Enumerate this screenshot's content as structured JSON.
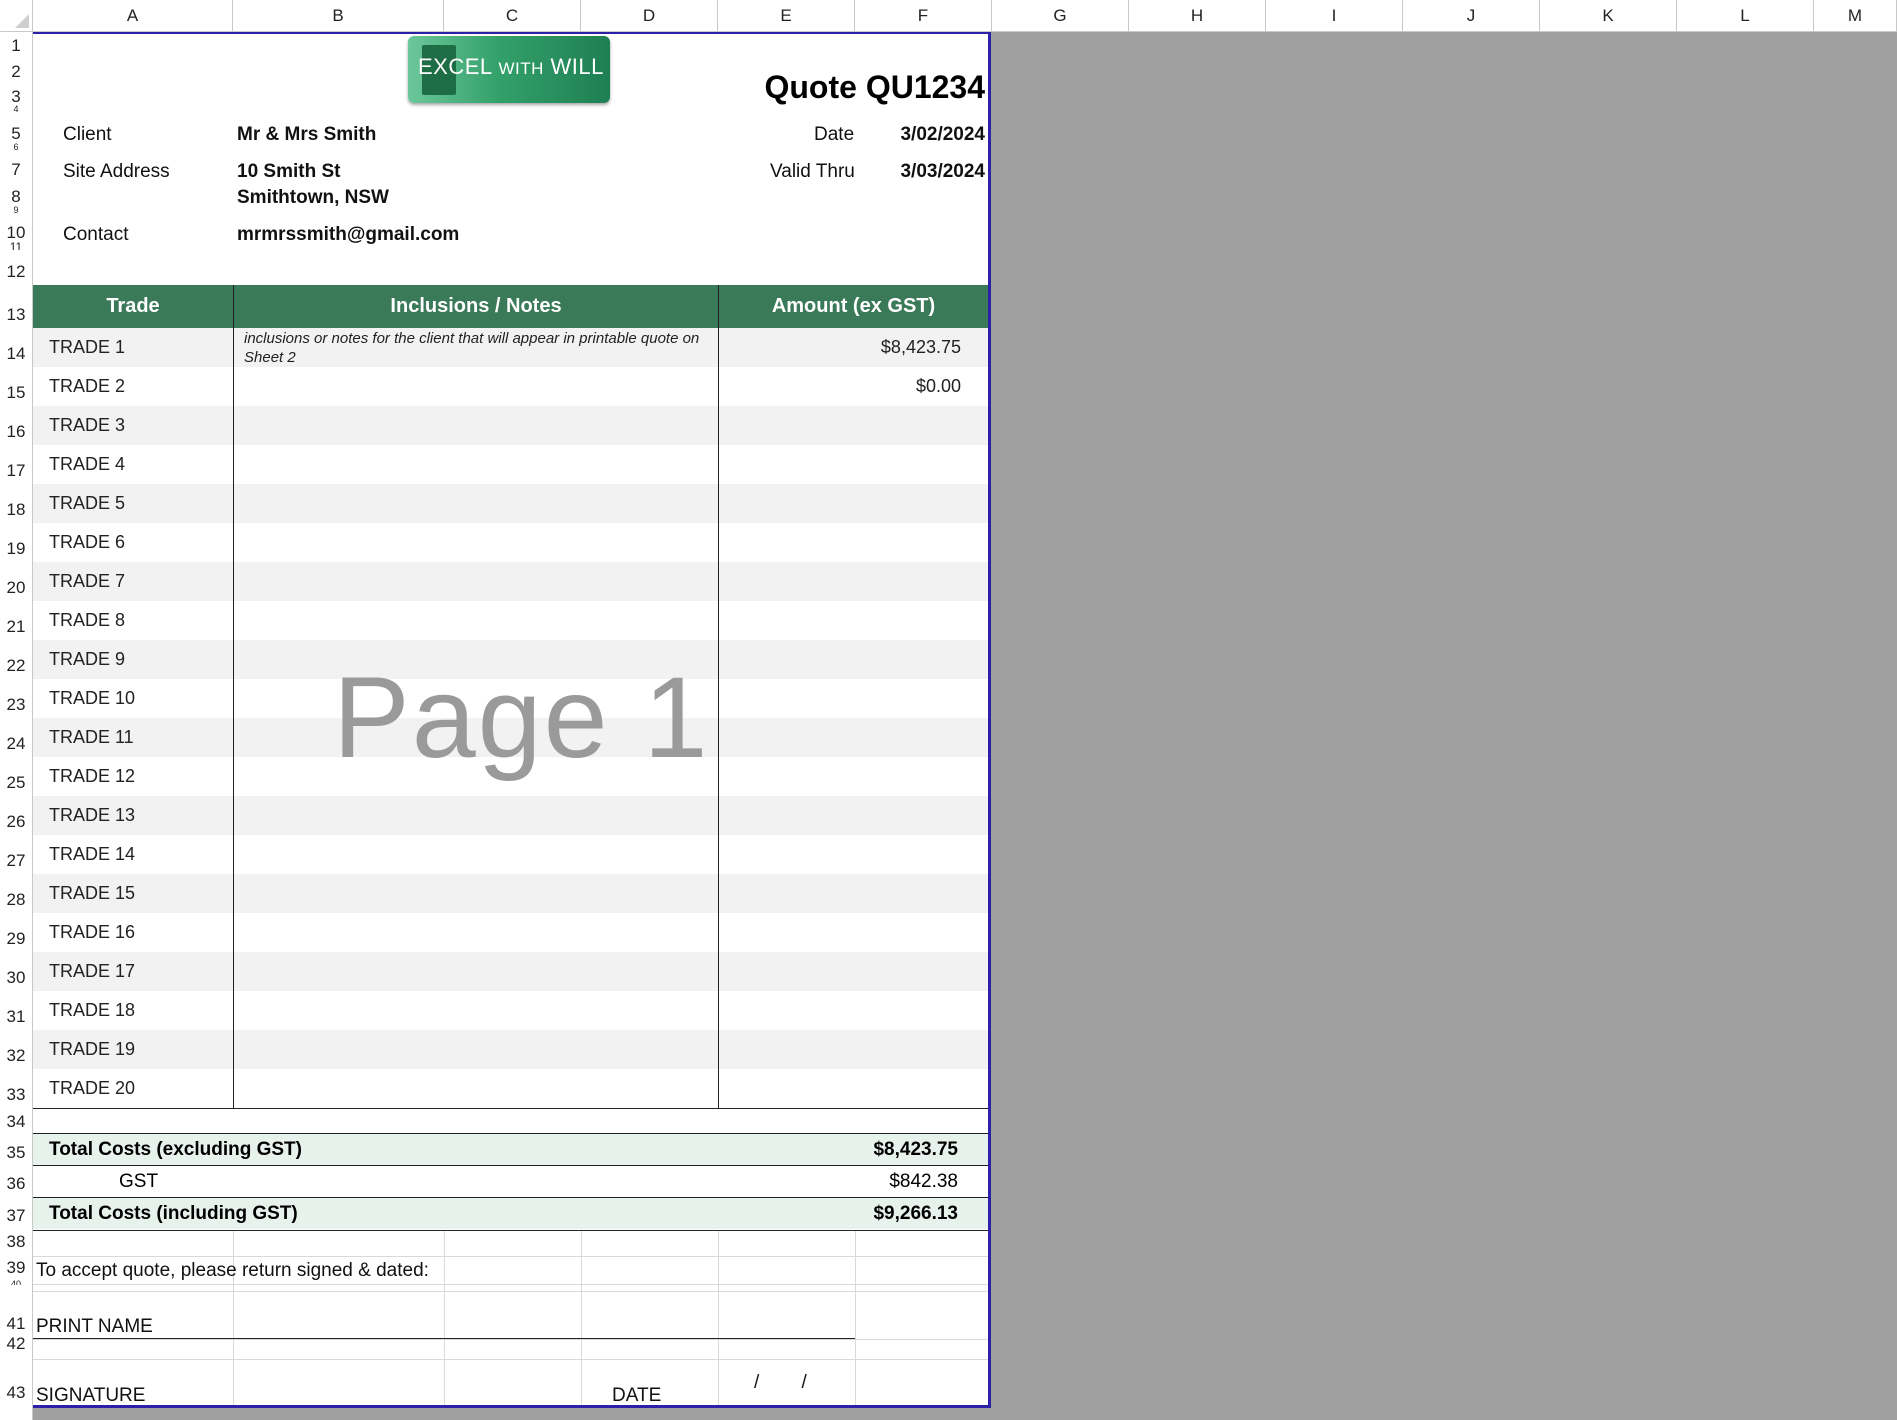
{
  "columns": [
    "A",
    "B",
    "C",
    "D",
    "E",
    "F",
    "G",
    "H",
    "I",
    "J",
    "K",
    "L",
    "M"
  ],
  "rows": [
    "1",
    "2",
    "3",
    "4",
    "5",
    "6",
    "7",
    "8",
    "9",
    "10",
    "11",
    "12",
    "13",
    "14",
    "15",
    "16",
    "17",
    "18",
    "19",
    "20",
    "21",
    "22",
    "23",
    "24",
    "25",
    "26",
    "27",
    "28",
    "29",
    "30",
    "31",
    "32",
    "33",
    "34",
    "35",
    "36",
    "37",
    "38",
    "39",
    "40",
    "41",
    "42",
    "43"
  ],
  "logo": {
    "text_main": "EXCEL",
    "text_with": "WITH",
    "text_name": "WILL"
  },
  "quote": {
    "title": "Quote QU1234",
    "client_label": "Client",
    "client_value": "Mr & Mrs Smith",
    "site_label": "Site Address",
    "site_line1": "10 Smith St",
    "site_line2": "Smithtown, NSW",
    "contact_label": "Contact",
    "contact_value": "mrmrssmith@gmail.com",
    "date_label": "Date",
    "date_value": "3/02/2024",
    "valid_label": "Valid Thru",
    "valid_value": "3/03/2024"
  },
  "table": {
    "headers": {
      "trade": "Trade",
      "notes": "Inclusions / Notes",
      "amount": "Amount (ex GST)"
    },
    "rows": [
      {
        "trade": "TRADE 1",
        "notes": "inclusions or notes for the client that will appear in printable quote on Sheet 2",
        "amount": "$8,423.75"
      },
      {
        "trade": "TRADE 2",
        "notes": "",
        "amount": "$0.00"
      },
      {
        "trade": "TRADE 3",
        "notes": "",
        "amount": ""
      },
      {
        "trade": "TRADE 4",
        "notes": "",
        "amount": ""
      },
      {
        "trade": "TRADE 5",
        "notes": "",
        "amount": ""
      },
      {
        "trade": "TRADE 6",
        "notes": "",
        "amount": ""
      },
      {
        "trade": "TRADE 7",
        "notes": "",
        "amount": ""
      },
      {
        "trade": "TRADE 8",
        "notes": "",
        "amount": ""
      },
      {
        "trade": "TRADE 9",
        "notes": "",
        "amount": ""
      },
      {
        "trade": "TRADE 10",
        "notes": "",
        "amount": ""
      },
      {
        "trade": "TRADE 11",
        "notes": "",
        "amount": ""
      },
      {
        "trade": "TRADE 12",
        "notes": "",
        "amount": ""
      },
      {
        "trade": "TRADE 13",
        "notes": "",
        "amount": ""
      },
      {
        "trade": "TRADE 14",
        "notes": "",
        "amount": ""
      },
      {
        "trade": "TRADE 15",
        "notes": "",
        "amount": ""
      },
      {
        "trade": "TRADE 16",
        "notes": "",
        "amount": ""
      },
      {
        "trade": "TRADE 17",
        "notes": "",
        "amount": ""
      },
      {
        "trade": "TRADE 18",
        "notes": "",
        "amount": ""
      },
      {
        "trade": "TRADE 19",
        "notes": "",
        "amount": ""
      },
      {
        "trade": "TRADE 20",
        "notes": "",
        "amount": ""
      }
    ]
  },
  "watermark": "Page 1",
  "totals": {
    "excl_label": "Total Costs (excluding GST)",
    "excl_value": "$8,423.75",
    "gst_label": "GST",
    "gst_value": "$842.38",
    "incl_label": "Total Costs (including GST)",
    "incl_value": "$9,266.13"
  },
  "accept": {
    "instruction": "To accept quote, please return signed & dated:",
    "print_name": "PRINT NAME",
    "signature": "SIGNATURE",
    "date": "DATE",
    "date_slashes": "/        /"
  },
  "colors": {
    "header_green": "#3a7a58",
    "page_border": "#2b20a6",
    "total_shade": "#e8f2ec",
    "outside_gray": "#a0a0a0"
  }
}
